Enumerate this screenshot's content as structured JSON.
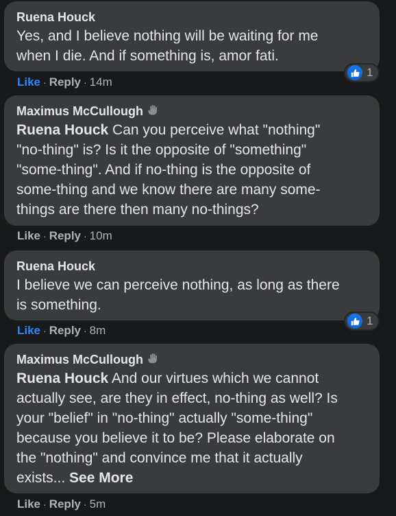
{
  "comments": [
    {
      "author": "Ruena Houck",
      "lines": [
        "Yes, and I believe nothing will be waiting for me",
        "when I die. And if something is, amor fati."
      ],
      "like": "Like",
      "reply": "Reply",
      "time": "14m",
      "reactions": "1"
    },
    {
      "author": "Maximus McCullough",
      "mention": "Ruena Houck",
      "first_line_rest": " Can you perceive what \"nothing\"",
      "lines": [
        "\"no-thing\" is? Is it the opposite of \"something\"",
        "\"some-thing\". And if no-thing is the opposite of",
        "some-thing and we know there are many some-",
        "things are there then many no-things?"
      ],
      "like": "Like",
      "reply": "Reply",
      "time": "10m"
    },
    {
      "author": "Ruena Houck",
      "lines": [
        "I believe we can perceive nothing, as long as there",
        "is something."
      ],
      "like": "Like",
      "reply": "Reply",
      "time": "8m",
      "reactions": "1"
    },
    {
      "author": "Maximus McCullough",
      "mention": "Ruena Houck",
      "first_line_rest": " And our virtues which we cannot",
      "lines": [
        "actually see, are they in effect, no-thing as well? Is",
        "your \"belief\" in \"no-thing\" actually \"some-thing\"",
        "because you believe it to be? Please elaborate on",
        "the \"nothing\" and convince me that it actually"
      ],
      "last_line": "exists... ",
      "see_more": "See More",
      "like": "Like",
      "reply": "Reply",
      "time": "5m"
    }
  ],
  "sep": "·"
}
